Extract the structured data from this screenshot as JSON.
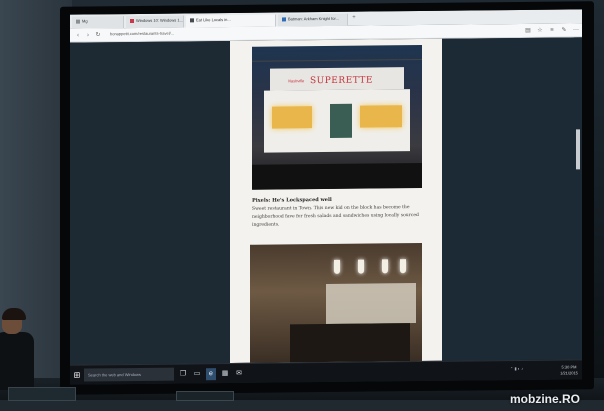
{
  "browser": {
    "tabs": [
      {
        "label": "Mg",
        "color": "#8a8f93"
      },
      {
        "label": "Windows 10: Windows 1...",
        "color": "#c9374a"
      },
      {
        "label": "Eat Like Locals in...",
        "color": "#444a50"
      },
      {
        "label": "Batman: Arkham Knight for...",
        "color": "#2d6db3"
      }
    ],
    "url": "bonappetit.com",
    "breadcrumb_tail": "/restaurants-travel/..."
  },
  "article": {
    "sign_main": "SUPERETTE",
    "sign_small": "Nashville",
    "caption_title": "Pixels: He's Lockspaced well",
    "caption_body": "Sweet restaurant in Town. This new kid on the block has become the neighborhood fave for fresh salads and sandwiches using locally sourced ingredients."
  },
  "taskbar": {
    "search_placeholder": "Search the web and Windows",
    "icons": [
      "task-view-icon",
      "file-explorer-icon",
      "edge-browser-icon",
      "store-icon",
      "mail-icon"
    ],
    "time": "5:30 PM",
    "date": "1/21/2015"
  },
  "watermark": "mobzine.RO",
  "colors": {
    "sign_red": "#c6323b",
    "window_glow": "#e9b64c",
    "taskbar_bg": "#101418",
    "active_task": "#2f4d6d"
  }
}
